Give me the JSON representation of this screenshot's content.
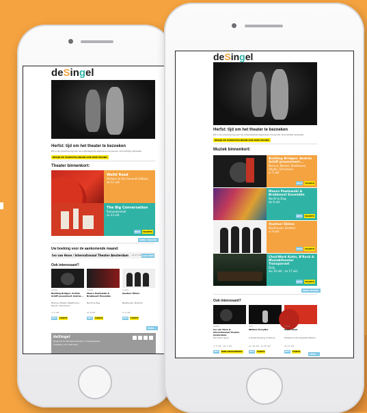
{
  "brand": {
    "logo_parts": [
      "de",
      "S",
      "in",
      "g",
      "el"
    ],
    "orange": "#F4A340",
    "teal": "#2FB3A5",
    "yellow": "#F5E400",
    "blue": "#7FC7E5"
  },
  "left": {
    "headline": "Herfst: tijd om het theater te bezoeken",
    "intro": "Dit is de omschrijving van de onderstaande algemene minuscule. Voorzichtigr template.",
    "cta": "BEKIJK DE VOORSTELLINGEN VAN DEZE MAAND",
    "section": "Theater binnenkort:",
    "cards": [
      {
        "title": "Walid Raad",
        "subtitle": "Preface to the Seventh Edition",
        "date": "do 11 okt"
      },
      {
        "title": "The Big Conversation",
        "subtitle": "Romeokomedi",
        "date": "za 23 okt"
      }
    ],
    "more_label": "MEER THEATER",
    "booking_title": "Uw boeking voor de aankomende maand:",
    "booking_text": "Ivo van Hove / Internationaal Theater Amsterdam",
    "booking_date": "za 27 okt",
    "booking_btn": "LAAT ZIEN",
    "interesting": "Ook interessant?",
    "items": [
      {
        "category": "muziek",
        "title": "Building Bridges: András Schiff presenteert András...",
        "desc": "Brenus, Mozart, Beethoven, Haydn, Schumann",
        "date": "vr 5 okt"
      },
      {
        "category": "muziek",
        "title": "Mauro Pawlowski & Brabbeant Ensemble",
        "desc": "Nacht & Dag",
        "date": "do 8 okt"
      },
      {
        "category": "muziek",
        "title": "Quatuor Ebène",
        "desc": "Beethoven, Brahms",
        "date": "vr 9 okt"
      }
    ],
    "tag_info": "INFO",
    "tag_tickets": "TICKETS",
    "more_small": "MEER...",
    "footer_name": "deSingel",
    "footer_lines": [
      "Desguinlei 25 | BE-2018 Antwerpen | info@desingel.be",
      "Ticketbalie +32 3 248 28 28"
    ]
  },
  "right": {
    "headline": "Herfst: tijd om het theater te bezoeken",
    "intro": "Dit is de omschrijving van de onderstaande algemene minuscule. Voorzichtigr template.",
    "cta": "BEKIJK DE VOORSTELLINGEN VAN DEZE MAAND",
    "section": "Muziek binnenkort:",
    "cards": [
      {
        "title": "Building Bridges: András Schiff presenteert...",
        "subtitle": "Brenus, Mozart, Beethoven, Haydn, Schumann",
        "date": "vr 5 okt"
      },
      {
        "title": "Mauro Pawlowski & Brabbeant Ensemble",
        "subtitle": "Nacht & Dag",
        "date": "do 8 okt"
      },
      {
        "title": "Quatuor Ebène",
        "subtitle": "Beethoven, Brahms",
        "date": "vr 9 okt"
      },
      {
        "title": "ChoirWork Kuhn, B'Rock & Muziektheater Transparant",
        "subtitle": "Dido",
        "date": "wo 10 okt - zo 17 okt"
      }
    ],
    "more_label": "MEER MUZIEK",
    "interesting": "Ook interessant?",
    "items": [
      {
        "category": "theater",
        "title": "Ivo van Hove & Internationaal Theater Amsterdam",
        "desc": "Een klein leven",
        "date": "vr 5 okt - wo 7 okt",
        "tag2": "BOEK GEPOSTERHEST"
      },
      {
        "category": "dans",
        "title": "William Forsythe",
        "desc": "A Quiet Evening of Dance",
        "date": "wo 16 okt - zo 20 okt",
        "tag2": "TICKETS"
      },
      {
        "category": "theater",
        "title": "Walid Raad",
        "desc": "Preface to the Seventh Edition",
        "date": "do 11 okt",
        "tag2": "TICKETS"
      }
    ],
    "tag_info": "INFO",
    "tag_tickets": "TICKETS",
    "more_small": "MEER..."
  }
}
